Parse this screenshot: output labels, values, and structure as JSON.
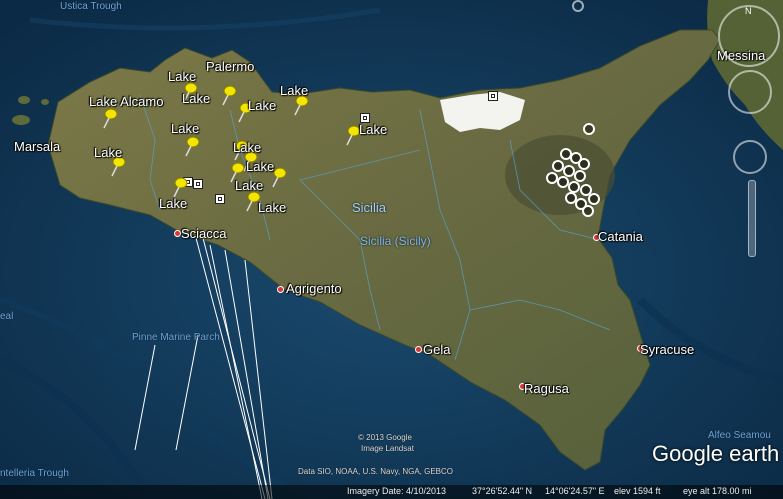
{
  "map": {
    "cities": {
      "palermo": "Palermo",
      "marsala": "Marsala",
      "sciacca": "Sciacca",
      "agrigento": "Agrigento",
      "gela": "Gela",
      "ragusa": "Ragusa",
      "syracuse": "Syracuse",
      "catania": "Catania",
      "messina": "Messina"
    },
    "regions": {
      "sicilia": "Sicilia",
      "sicilia_sicily": "Sicilia (Sicily)"
    },
    "sea_features": {
      "ustica_trough": "Ustica Trough",
      "pinne_marine_parch": "Pinne Marine Parch",
      "telleria_trough": "ntelleria Trough",
      "alfeo_seamount": "Alfeo Seamou",
      "left_edge": "eal"
    },
    "placemarks": {
      "lake_alcamo": "Lake Alcamo",
      "lake": "Lake"
    },
    "credits": {
      "copyright": "© 2013 Google",
      "image_source": "Image Landsat",
      "data": "Data SIO, NOAA, U.S. Navy, NGA, GEBCO"
    },
    "logo": {
      "google": "Google",
      "earth": "earth"
    }
  },
  "status": {
    "imagery_date": "Imagery Date: 4/10/2013",
    "lat": "37°26'52.44\" N",
    "lon": "14°06'24.57\" E",
    "elev": "elev  1594 ft",
    "eye_alt": "eye alt 178.00 mi"
  },
  "colors": {
    "sea": "#0d3150",
    "land": "#6b6e44",
    "pin": "#f2e600"
  },
  "icons": [
    "yellow-pushpin-icon",
    "square-marker-icon",
    "ring-marker-icon",
    "red-dot-icon",
    "compass-icon",
    "look-joystick-icon",
    "zoom-slider-icon"
  ]
}
